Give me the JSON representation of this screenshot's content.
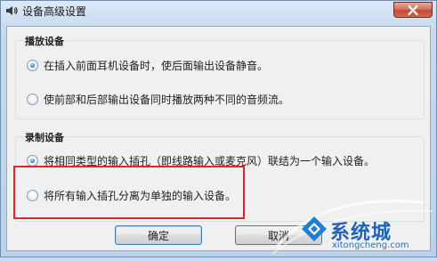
{
  "window": {
    "title": "设备高级设置",
    "close_icon": "close-icon",
    "app_icon": "speaker-icon"
  },
  "playback_group": {
    "legend": "播放设备",
    "options": [
      {
        "label": "在插入前面耳机设备时，使后面输出设备静音。",
        "checked": true
      },
      {
        "label": "使前部和后部输出设备同时播放两种不同的音频流。",
        "checked": false
      }
    ]
  },
  "recording_group": {
    "legend": "录制设备",
    "options": [
      {
        "label": "将相同类型的输入插孔（即线路输入或麦克风）联结为一个输入设备。",
        "checked": true
      },
      {
        "label": "将所有输入插孔分离为单独的输入设备。",
        "checked": false
      }
    ]
  },
  "buttons": {
    "ok": "确定",
    "cancel": "取消"
  },
  "watermark": {
    "brand": "系统城",
    "url": "xitongcheng.com"
  },
  "colors": {
    "highlight": "#e0262c",
    "radio_selected": "#2f8bd6"
  }
}
